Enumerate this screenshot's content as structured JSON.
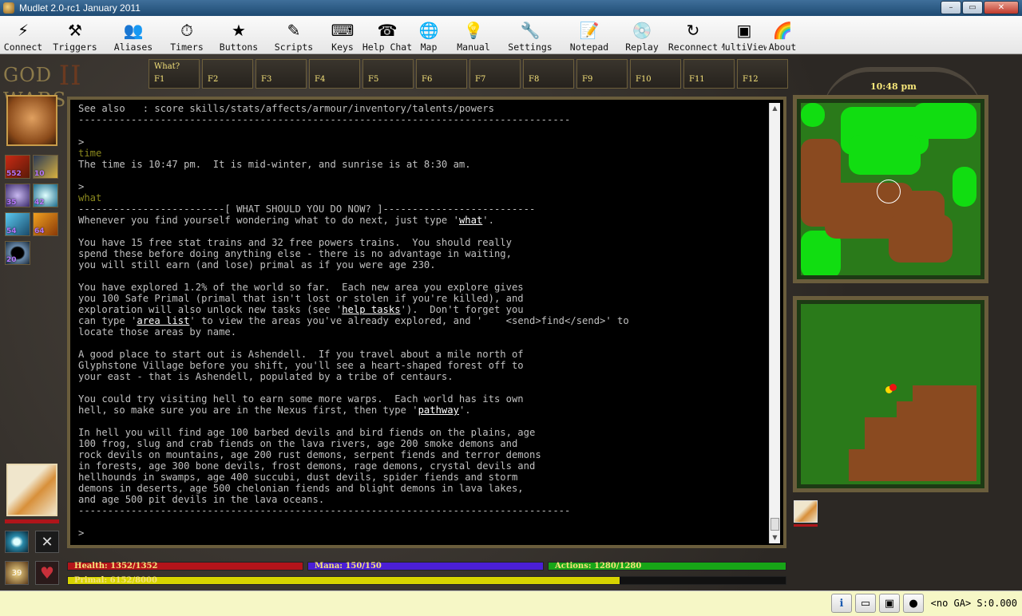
{
  "window": {
    "title": "Mudlet 2.0-rc1 January 2011",
    "minimize": "–",
    "maximize": "▭",
    "close": "✕"
  },
  "toolbar": [
    {
      "id": "connect",
      "label": "Connect",
      "icon": "⚡"
    },
    {
      "id": "triggers",
      "label": "Triggers",
      "icon": "⚒"
    },
    {
      "id": "aliases",
      "label": "Aliases",
      "icon": "👥"
    },
    {
      "id": "timers",
      "label": "Timers",
      "icon": "⏱"
    },
    {
      "id": "buttons",
      "label": "Buttons",
      "icon": "★"
    },
    {
      "id": "scripts",
      "label": "Scripts",
      "icon": "✎"
    },
    {
      "id": "keys",
      "label": "Keys",
      "icon": "⌨"
    },
    {
      "id": "helpchat",
      "label": "Help Chat",
      "icon": "☎"
    },
    {
      "id": "map",
      "label": "Map",
      "icon": "🌐"
    },
    {
      "id": "manual",
      "label": "Manual",
      "icon": "💡"
    },
    {
      "id": "settings",
      "label": "Settings",
      "icon": "🔧"
    },
    {
      "id": "notepad",
      "label": "Notepad",
      "icon": "📝"
    },
    {
      "id": "replay",
      "label": "Replay",
      "icon": "💿"
    },
    {
      "id": "reconnect",
      "label": "Reconnect",
      "icon": "↻"
    },
    {
      "id": "multiview",
      "label": "MultiView",
      "icon": "▣"
    },
    {
      "id": "about",
      "label": "About",
      "icon": "🌈"
    }
  ],
  "game": {
    "logo": {
      "left": "GOD",
      "mid": "II",
      "right": "WARS"
    },
    "fkeys": [
      {
        "top": "What?",
        "key": "F1"
      },
      {
        "top": "",
        "key": "F2"
      },
      {
        "top": "",
        "key": "F3"
      },
      {
        "top": "",
        "key": "F4"
      },
      {
        "top": "",
        "key": "F5"
      },
      {
        "top": "",
        "key": "F6"
      },
      {
        "top": "",
        "key": "F7"
      },
      {
        "top": "",
        "key": "F8"
      },
      {
        "top": "",
        "key": "F9"
      },
      {
        "top": "",
        "key": "F10"
      },
      {
        "top": "",
        "key": "F11"
      },
      {
        "top": "",
        "key": "F12"
      }
    ],
    "clock": "10:48 pm",
    "skills": [
      "552",
      "10",
      "35",
      "42",
      "54",
      "64",
      "20"
    ],
    "level": "39",
    "bars": {
      "health": {
        "label": "Health: 1352/1352",
        "fraction": 1.0,
        "color": "#b3141a"
      },
      "mana": {
        "label": "Mana: 150/150",
        "fraction": 1.0,
        "color": "#4b1fd6"
      },
      "actions": {
        "label": "Actions: 1280/1280",
        "fraction": 1.0,
        "color": "#17a517"
      },
      "primal": {
        "label": "Primal: 6152/8000",
        "fraction": 0.769,
        "color": "#d7d400"
      }
    }
  },
  "output": {
    "l01": "See also   : score skills/stats/affects/armour/inventory/talents/powers",
    "l02": "------------------------------------------------------------------------------------",
    "l03": ">",
    "l04": "time",
    "l05": "The time is 10:47 pm.  It is mid-winter, and sunrise is at 8:30 am.",
    "l06": ">",
    "l07": "what",
    "l08": "-------------------------[ WHAT SHOULD YOU DO NOW? ]--------------------------",
    "l09a": "Whenever you find yourself wondering what to do next, just type '",
    "l09b": "what",
    "l09c": "'.",
    "l10": "You have 15 free stat trains and 32 free powers trains.  You should really",
    "l11": "spend these before doing anything else - there is no advantage in waiting,",
    "l12": "you will still earn (and lose) primal as if you were age 230.",
    "l13": "You have explored 1.2% of the world so far.  Each new area you explore gives",
    "l14": "you 100 Safe Primal (primal that isn't lost or stolen if you're killed), and",
    "l15a": "exploration will also unlock new tasks (see '",
    "l15b": "help tasks",
    "l15c": "').  Don't forget you",
    "l16a": "can type '",
    "l16b": "area list",
    "l16c": "' to view the areas you've already explored, and '    <send>find</send>' to",
    "l17": "locate those areas by name.",
    "l18": "A good place to start out is Ashendell.  If you travel about a mile north of",
    "l19": "Glyphstone Village before you shift, you'll see a heart-shaped forest off to",
    "l20": "your east - that is Ashendell, populated by a tribe of centaurs.",
    "l21": "You could try visiting hell to earn some more warps.  Each world has its own",
    "l22a": "hell, so make sure you are in the Nexus first, then type '",
    "l22b": "pathway",
    "l22c": "'.",
    "l23": "In hell you will find age 100 barbed devils and bird fiends on the plains, age",
    "l24": "100 frog, slug and crab fiends on the lava rivers, age 200 smoke demons and",
    "l25": "rock devils on mountains, age 200 rust demons, serpent fiends and terror demons",
    "l26": "in forests, age 300 bone devils, frost demons, rage demons, crystal devils and",
    "l27": "hellhounds in swamps, age 400 succubi, dust devils, spider fiends and storm",
    "l28": "demons in deserts, age 500 chelonian fiends and blight demons in lava lakes,",
    "l29": "and age 500 pit devils in the lava oceans.",
    "l30": "------------------------------------------------------------------------------------",
    "l31": ">"
  },
  "statusbar": {
    "ga_text": "<no GA> S:0.000"
  }
}
